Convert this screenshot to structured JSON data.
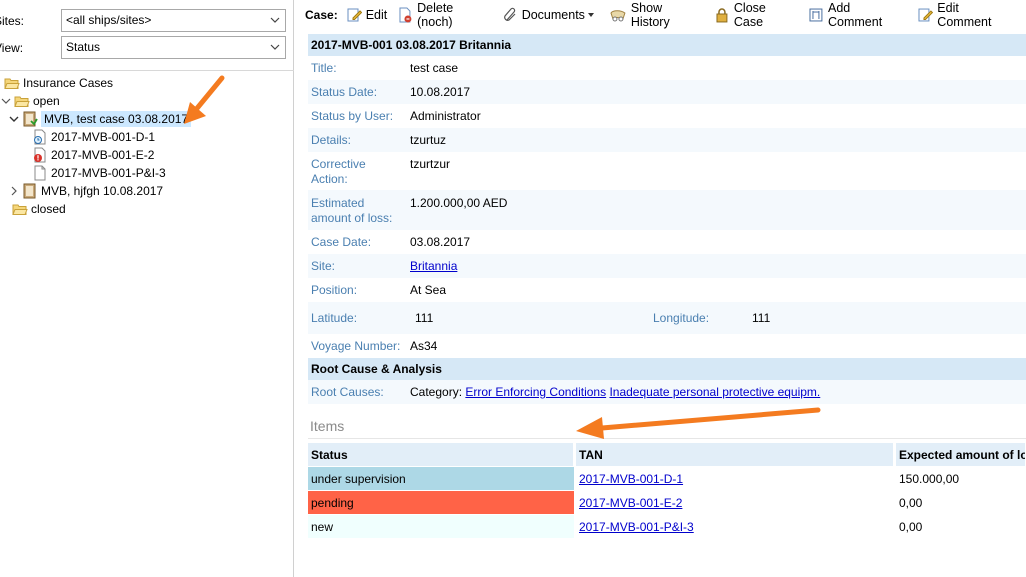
{
  "filters": {
    "sites_label": "Sites:",
    "sites_value": "<all ships/sites>",
    "view_label": "View:",
    "view_value": "Status"
  },
  "tree": {
    "root": "Insurance Cases",
    "open": "open",
    "case1": "MVB, test case 03.08.2017",
    "child1": "2017-MVB-001-D-1",
    "child2": "2017-MVB-001-E-2",
    "child3": "2017-MVB-001-P&I-3",
    "case2": "MVB, hjfgh 10.08.2017",
    "closed": "closed"
  },
  "toolbar": {
    "case_label": "Case:",
    "edit": "Edit",
    "delete": "Delete (noch)",
    "documents": "Documents",
    "show_history": "Show History",
    "close_case": "Close Case",
    "add_comment": "Add Comment",
    "edit_comment": "Edit Comment"
  },
  "case": {
    "header": "2017-MVB-001 03.08.2017 Britannia",
    "title_label": "Title:",
    "title": "test case",
    "status_date_label": "Status Date:",
    "status_date": "10.08.2017",
    "status_by_label": "Status by User:",
    "status_by": "Administrator",
    "details_label": "Details:",
    "details": "tzurtuz",
    "corrective_label_1": "Corrective",
    "corrective_label_2": "Action:",
    "corrective": "tzurtzur",
    "est_label_1": "Estimated",
    "est_label_2": "amount of loss:",
    "est": "1.200.000,00 AED",
    "case_date_label": "Case Date:",
    "case_date": "03.08.2017",
    "site_label": "Site:",
    "site": "Britannia",
    "position_label": "Position:",
    "position": "At Sea",
    "latitude_label": "Latitude:",
    "latitude": "111",
    "longitude_label": "Longitude:",
    "longitude": "111",
    "voyage_label": "Voyage Number:",
    "voyage": "As34"
  },
  "root_cause": {
    "header": "Root Cause & Analysis",
    "label": "Root Causes:",
    "category": "Category:",
    "cause1": "Error Enforcing Conditions",
    "cause2": "Inadequate personal protective equipm."
  },
  "items": {
    "title": "Items",
    "columns": [
      "Status",
      "TAN",
      "Expected amount of loss"
    ],
    "rows": [
      {
        "status": "under supervision",
        "tan": "2017-MVB-001-D-1",
        "amount": "150.000,00",
        "color": "#add8e6"
      },
      {
        "status": "pending",
        "tan": "2017-MVB-001-E-2",
        "amount": "0,00",
        "color": "#ff6347"
      },
      {
        "status": "new",
        "tan": "2017-MVB-001-P&I-3",
        "amount": "0,00",
        "color": "#f0fffe"
      }
    ]
  },
  "colors": {
    "accent_arrow": "#f47b20",
    "section_header": "#d6e8f6",
    "label_blue": "#4a7fb0"
  }
}
